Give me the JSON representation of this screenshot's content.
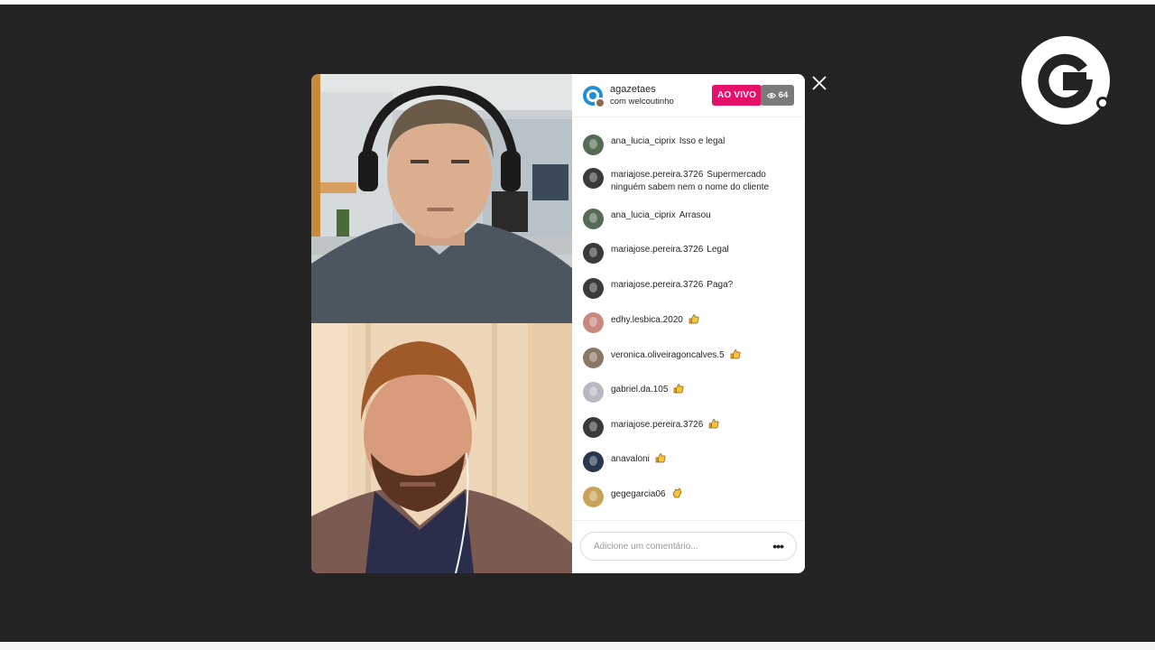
{
  "header": {
    "host_username": "agazetaes",
    "with_text": "com welcoutinho",
    "live_label": "AO VIVO",
    "viewer_count": "64"
  },
  "comments": [
    {
      "user": "ana_lucia_ciprix",
      "text": "Isso e legal",
      "avatar_color": "#556b55"
    },
    {
      "user": "mariajose.pereira.3726",
      "text": "Supermercado ninguém sabem nem o nome do cliente",
      "avatar_color": "#3a3a3a"
    },
    {
      "user": "ana_lucia_ciprix",
      "text": "Arrasou",
      "avatar_color": "#556b55"
    },
    {
      "user": "mariajose.pereira.3726",
      "text": "Legal",
      "avatar_color": "#3a3a3a"
    },
    {
      "user": "mariajose.pereira.3726",
      "text": "Paga?",
      "avatar_color": "#3a3a3a"
    },
    {
      "user": "edhy.lesbica.2020",
      "text": "",
      "emoji": "thumbs-up",
      "avatar_color": "#c9887e"
    },
    {
      "user": "veronica.oliveiragoncalves.5",
      "text": "",
      "emoji": "thumbs-up",
      "avatar_color": "#8a7866"
    },
    {
      "user": "gabriel.da.105",
      "text": "",
      "emoji": "thumbs-up",
      "avatar_color": "#b8b8c2"
    },
    {
      "user": "mariajose.pereira.3726",
      "text": "",
      "emoji": "thumbs-up",
      "avatar_color": "#3a3a3a"
    },
    {
      "user": "anavaloni",
      "text": "",
      "emoji": "thumbs-up",
      "avatar_color": "#2a3550"
    },
    {
      "user": "gegegarcia06",
      "text": "",
      "emoji": "clap",
      "avatar_color": "#c9a35a"
    }
  ],
  "comment_input": {
    "placeholder": "Adicione um comentário..."
  },
  "colors": {
    "live_badge": "#e5106a",
    "viewer_badge": "#7a7a7a",
    "stage_bg": "#232323"
  },
  "icons": {
    "close": "close-icon",
    "viewers": "eye-icon",
    "more": "more-options-icon",
    "brand": "g-logo-icon"
  }
}
